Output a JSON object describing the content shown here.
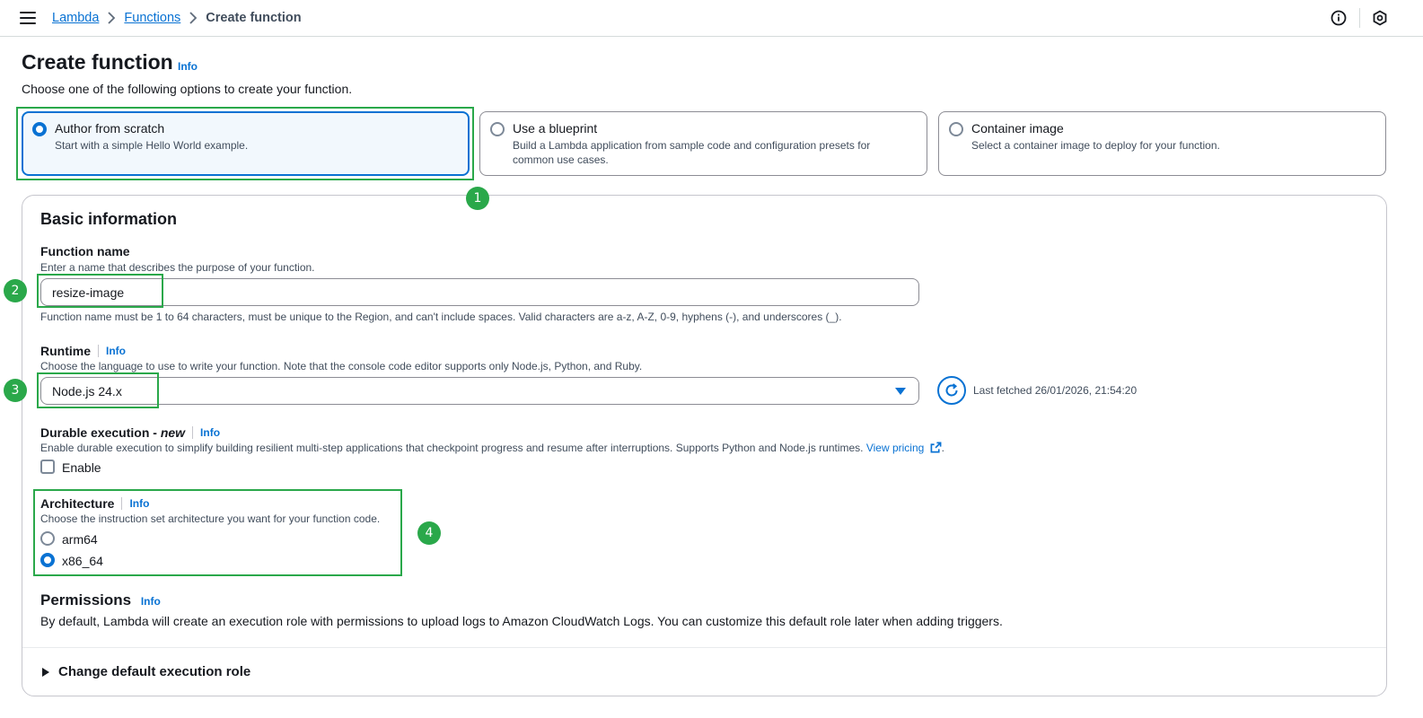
{
  "breadcrumb": {
    "items": [
      "Lambda",
      "Functions"
    ],
    "current": "Create function"
  },
  "header": {
    "title": "Create function",
    "info": "Info",
    "subtitle": "Choose one of the following options to create your function."
  },
  "options": [
    {
      "title": "Author from scratch",
      "desc": "Start with a simple Hello World example.",
      "selected": true
    },
    {
      "title": "Use a blueprint",
      "desc": "Build a Lambda application from sample code and configuration presets for common use cases.",
      "selected": false
    },
    {
      "title": "Container image",
      "desc": "Select a container image to deploy for your function.",
      "selected": false
    }
  ],
  "annotations": [
    "1",
    "2",
    "3",
    "4"
  ],
  "basic_info": {
    "title": "Basic information",
    "function_name": {
      "label": "Function name",
      "desc": "Enter a name that describes the purpose of your function.",
      "value": "resize-image",
      "constraint": "Function name must be 1 to 64 characters, must be unique to the Region, and can't include spaces. Valid characters are a-z, A-Z, 0-9, hyphens (-), and underscores (_)."
    },
    "runtime": {
      "label": "Runtime",
      "info": "Info",
      "desc": "Choose the language to use to write your function. Note that the console code editor supports only Node.js, Python, and Ruby.",
      "value": "Node.js 24.x",
      "fetched": "Last fetched 26/01/2026, 21:54:20"
    },
    "durable": {
      "label": "Durable execution - ",
      "label_new": "new",
      "info": "Info",
      "desc": "Enable durable execution to simplify building resilient multi-step applications that checkpoint progress and resume after interruptions. Supports Python and Node.js runtimes.",
      "link": "View pricing",
      "checkbox_label": "Enable",
      "checked": false
    },
    "architecture": {
      "label": "Architecture",
      "info": "Info",
      "desc": "Choose the instruction set architecture you want for your function code.",
      "options": [
        "arm64",
        "x86_64"
      ],
      "selected": "x86_64"
    },
    "permissions": {
      "title": "Permissions",
      "info": "Info",
      "desc": "By default, Lambda will create an execution role with permissions to upload logs to Amazon CloudWatch Logs. You can customize this default role later when adding triggers."
    },
    "expander": "Change default execution role"
  },
  "colors": {
    "accent": "#0972d3",
    "annotation": "#2aa84a"
  },
  "icons": [
    "menu-icon",
    "chevron-right-icon",
    "info-circle-icon",
    "notifications-icon",
    "refresh-icon",
    "external-link-icon",
    "caret-down-icon"
  ]
}
